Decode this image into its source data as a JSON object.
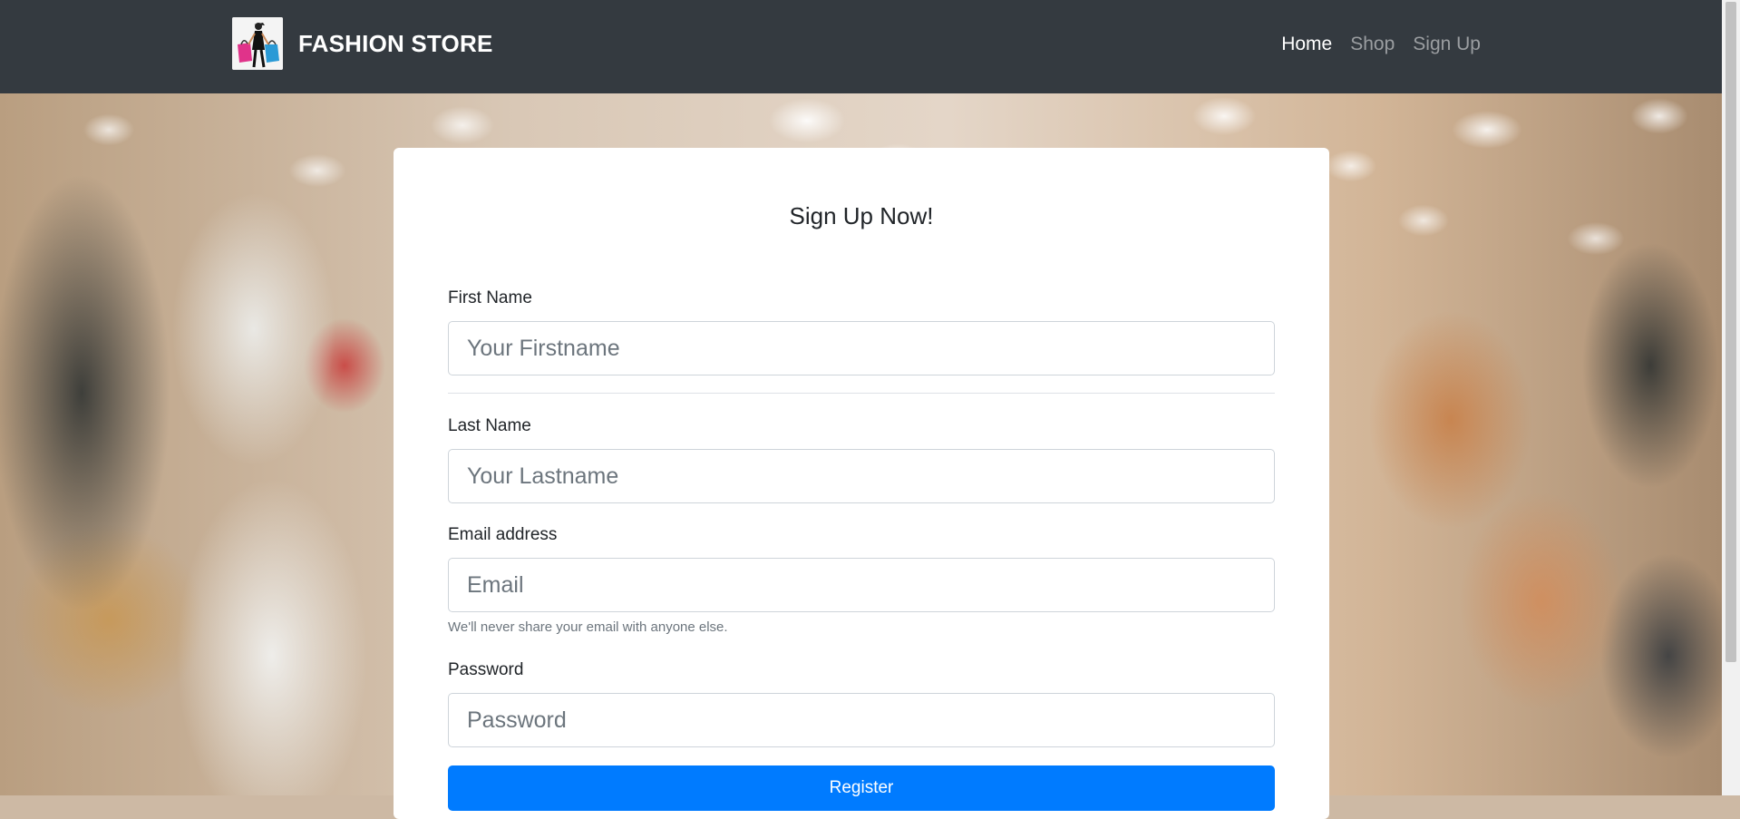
{
  "navbar": {
    "brand": "FASHION STORE",
    "logo_icon": "shopping-bags-logo",
    "links": [
      {
        "label": "Home",
        "active": true
      },
      {
        "label": "Shop",
        "active": false
      },
      {
        "label": "Sign Up",
        "active": false
      }
    ]
  },
  "form": {
    "title": "Sign Up Now!",
    "first_name": {
      "label": "First Name",
      "placeholder": "Your Firstname"
    },
    "last_name": {
      "label": "Last Name",
      "placeholder": "Your Lastname"
    },
    "email": {
      "label": "Email address",
      "placeholder": "Email",
      "help": "We'll never share your email with anyone else."
    },
    "password": {
      "label": "Password",
      "placeholder": "Password"
    },
    "submit_label": "Register"
  },
  "colors": {
    "navbar": "#343a40",
    "primary": "#007bff"
  }
}
